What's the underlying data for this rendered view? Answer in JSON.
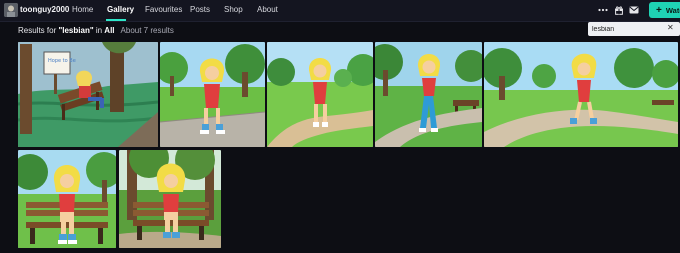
{
  "header": {
    "username": "toonguy2000",
    "nav": [
      {
        "label": "Home"
      },
      {
        "label": "Gallery"
      },
      {
        "label": "Favourites"
      },
      {
        "label": "Posts"
      },
      {
        "label": "Shop"
      },
      {
        "label": "About"
      }
    ],
    "active_nav": "Gallery",
    "icons": [
      "more-icon",
      "gift-icon",
      "mail-icon"
    ],
    "watch_label": "Watc",
    "accent_color": "#1fd3b4"
  },
  "search": {
    "results_prefix": "Results for ",
    "query_quoted": "\"lesbian\"",
    "in_text": " in ",
    "scope": "All",
    "count_text": "About 7 results",
    "value": "lesbian",
    "close_glyph": "✕"
  },
  "gallery": {
    "items": [
      {
        "style": "crayon-bench-sign",
        "sign_text": "Hope to Be"
      },
      {
        "style": "park-walk-red"
      },
      {
        "style": "park-walk-red-path"
      },
      {
        "style": "park-walk-blue-pants"
      },
      {
        "style": "park-walk-wide"
      },
      {
        "style": "bench-sitting"
      },
      {
        "style": "bench-sitting-forest"
      }
    ]
  }
}
